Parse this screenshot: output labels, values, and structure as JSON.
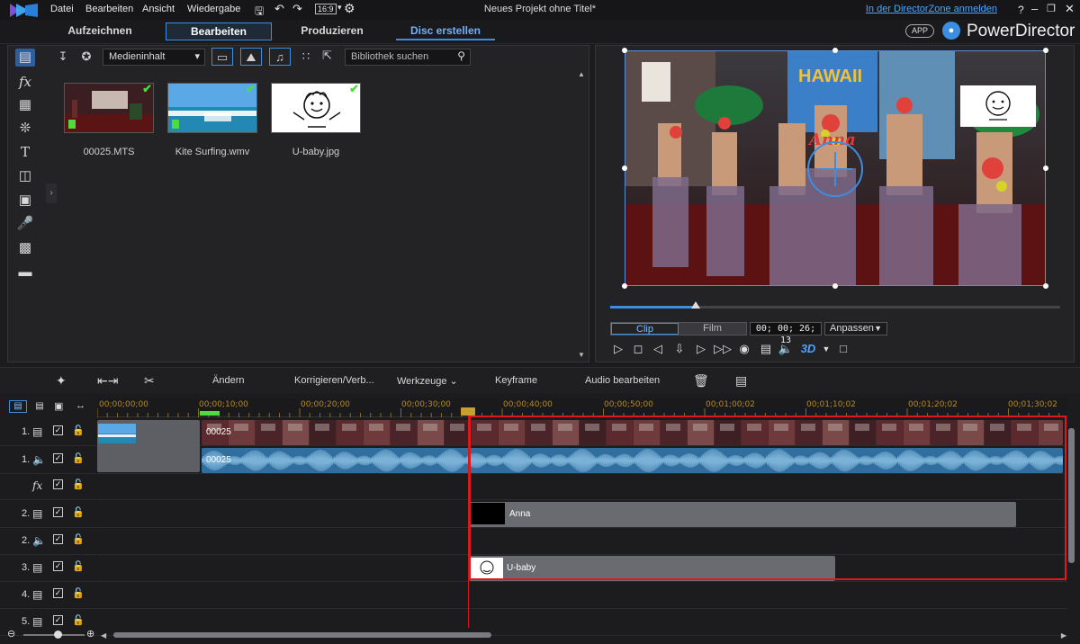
{
  "menu": {
    "items": [
      "Datei",
      "Bearbeiten",
      "Ansicht",
      "Wiedergabe"
    ],
    "aspect": "16:9",
    "window_title": "Neues Projekt ohne Titel*",
    "directorzone_link": "In der DirectorZone anmelden",
    "help": "?"
  },
  "modes": {
    "capture": "Aufzeichnen",
    "edit": "Bearbeiten",
    "produce": "Produzieren",
    "disc": "Disc erstellen",
    "app_badge": "APP",
    "brand": "PowerDirector"
  },
  "library": {
    "media_select": "Medieninhalt",
    "search_placeholder": "Bibliothek suchen",
    "items": [
      {
        "label": "00025.MTS",
        "checked": true
      },
      {
        "label": "Kite Surfing.wmv",
        "checked": true
      },
      {
        "label": "U-baby.jpg",
        "checked": true
      }
    ]
  },
  "preview": {
    "clip_tab": "Clip",
    "film_tab": "Film",
    "timecode": "00; 00; 26; 13",
    "fit_select": "Anpassen",
    "progress": 0.19,
    "overlay_text": "Anna",
    "stereo_label": "3D"
  },
  "edit_toolbar": {
    "modify": "Ändern",
    "fix": "Korrigieren/Verb...",
    "tools": "Werkzeuge",
    "keyframe": "Keyframe",
    "audio_edit": "Audio bearbeiten"
  },
  "timeline": {
    "ruler_labels": [
      "00;00;00;00",
      "00;00;10;00",
      "00;00;20;00",
      "00;00;30;00",
      "00;00;40;00",
      "00;00;50;00",
      "00;01;00;02",
      "00;01;10;02",
      "00;01;20;02",
      "00;01;30;02"
    ],
    "tracks": [
      {
        "num": "1.",
        "kind": "video"
      },
      {
        "num": "1.",
        "kind": "audio"
      },
      {
        "num": "",
        "kind": "fx"
      },
      {
        "num": "2.",
        "kind": "video"
      },
      {
        "num": "2.",
        "kind": "audio"
      },
      {
        "num": "3.",
        "kind": "video"
      },
      {
        "num": "4.",
        "kind": "video"
      },
      {
        "num": "5.",
        "kind": "video"
      }
    ],
    "clips": {
      "video_main": "00025",
      "audio_main": "00025",
      "title_clip": "Anna",
      "image_clip": "U-baby"
    }
  },
  "colors": {
    "accent": "#3c8ee0",
    "selection": "#e0171f",
    "playhead": "#d21a1a",
    "check": "#4ddc3c",
    "audio_clip": "#2f6e9e"
  },
  "icons": {
    "logo": "powerdirector-logo-icon",
    "notification": "bell-icon",
    "search": "search-icon",
    "fx": "fx-icon"
  }
}
